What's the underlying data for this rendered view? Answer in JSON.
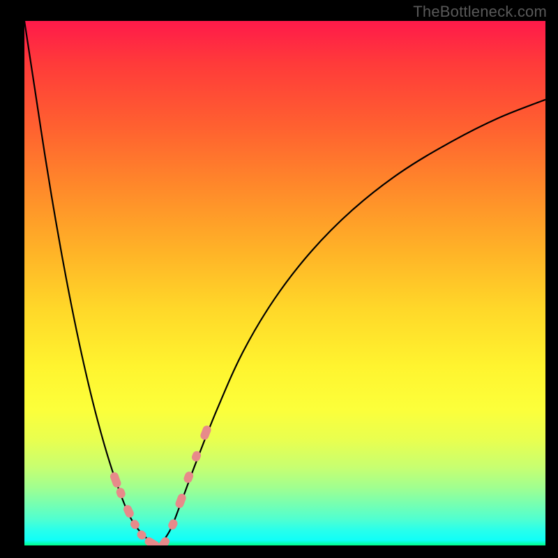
{
  "watermark": "TheBottleneck.com",
  "chart_data": {
    "type": "line",
    "title": "",
    "xlabel": "",
    "ylabel": "",
    "xlim": [
      0,
      1
    ],
    "ylim": [
      0,
      1
    ],
    "grid": false,
    "legend": false,
    "background_gradient": {
      "top": "#ff1a4a",
      "bottom": "#00ff88",
      "description": "red (high bottleneck) at top fading through orange/yellow to green (no bottleneck) at bottom"
    },
    "series": [
      {
        "name": "left-branch",
        "x": [
          0.0,
          0.02,
          0.04,
          0.06,
          0.08,
          0.1,
          0.12,
          0.14,
          0.16,
          0.18,
          0.2,
          0.215,
          0.23,
          0.245,
          0.26
        ],
        "y": [
          1.0,
          0.87,
          0.74,
          0.62,
          0.51,
          0.41,
          0.32,
          0.24,
          0.17,
          0.11,
          0.06,
          0.035,
          0.018,
          0.006,
          0.0
        ],
        "stroke": "#000000",
        "width": 2
      },
      {
        "name": "right-branch",
        "x": [
          0.26,
          0.28,
          0.3,
          0.33,
          0.37,
          0.42,
          0.48,
          0.55,
          0.63,
          0.72,
          0.82,
          0.91,
          1.0
        ],
        "y": [
          0.0,
          0.03,
          0.08,
          0.16,
          0.26,
          0.37,
          0.47,
          0.56,
          0.64,
          0.71,
          0.77,
          0.815,
          0.85
        ],
        "stroke": "#000000",
        "width": 2
      }
    ],
    "markers": {
      "name": "marker-points",
      "color": "#e78a8a",
      "shape": "rounded-rect",
      "points": [
        {
          "x": 0.175,
          "y": 0.125,
          "len": 0.03
        },
        {
          "x": 0.185,
          "y": 0.1,
          "len": 0.02
        },
        {
          "x": 0.2,
          "y": 0.065,
          "len": 0.025
        },
        {
          "x": 0.212,
          "y": 0.04,
          "len": 0.018
        },
        {
          "x": 0.225,
          "y": 0.02,
          "len": 0.018
        },
        {
          "x": 0.245,
          "y": 0.004,
          "len": 0.03
        },
        {
          "x": 0.268,
          "y": 0.004,
          "len": 0.025
        },
        {
          "x": 0.285,
          "y": 0.04,
          "len": 0.02
        },
        {
          "x": 0.3,
          "y": 0.085,
          "len": 0.028
        },
        {
          "x": 0.315,
          "y": 0.13,
          "len": 0.022
        },
        {
          "x": 0.33,
          "y": 0.17,
          "len": 0.02
        },
        {
          "x": 0.348,
          "y": 0.215,
          "len": 0.028
        }
      ]
    }
  }
}
